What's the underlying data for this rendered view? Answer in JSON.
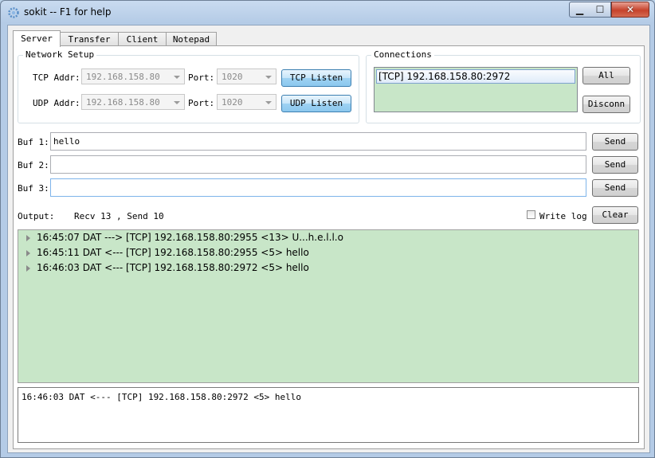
{
  "window": {
    "title": "sokit -- F1 for help"
  },
  "tabs": [
    {
      "label": "Server",
      "active": true
    },
    {
      "label": "Transfer"
    },
    {
      "label": "Client"
    },
    {
      "label": "Notepad"
    }
  ],
  "network_setup": {
    "title": "Network Setup",
    "tcp_addr_label": "TCP Addr:",
    "tcp_addr_value": "192.168.158.80",
    "tcp_port_label": "Port:",
    "tcp_port_value": "1020",
    "tcp_listen_label": "TCP Listen",
    "udp_addr_label": "UDP Addr:",
    "udp_addr_value": "192.168.158.80",
    "udp_port_label": "Port:",
    "udp_port_value": "1020",
    "udp_listen_label": "UDP Listen"
  },
  "connections": {
    "title": "Connections",
    "items": [
      "[TCP] 192.168.158.80:2972"
    ],
    "all_label": "All",
    "disconn_label": "Disconn"
  },
  "buffers": [
    {
      "label": "Buf 1:",
      "value": "hello",
      "send_label": "Send"
    },
    {
      "label": "Buf 2:",
      "value": "",
      "send_label": "Send"
    },
    {
      "label": "Buf 3:",
      "value": "",
      "send_label": "Send"
    }
  ],
  "output": {
    "label": "Output:",
    "stats": "Recv 13 , Send 10",
    "write_log_label": "Write log",
    "write_log_checked": false,
    "clear_label": "Clear"
  },
  "log": [
    "16:45:07 DAT ---> [TCP] 192.168.158.80:2955 <13> U...h.e.l.l.o",
    "16:45:11 DAT <--- [TCP] 192.168.158.80:2955 <5> hello",
    "16:46:03 DAT <--- [TCP] 192.168.158.80:2972 <5> hello"
  ],
  "detail": "16:46:03 DAT <--- [TCP] 192.168.158.80:2972 <5> hello",
  "colors": {
    "log_bg": "#c8e6c8",
    "accent_button": "#9ed2f3"
  },
  "icons": {
    "app": "gear-icon",
    "minimize": "minimize-icon",
    "maximize": "maximize-icon",
    "close": "close-icon"
  }
}
